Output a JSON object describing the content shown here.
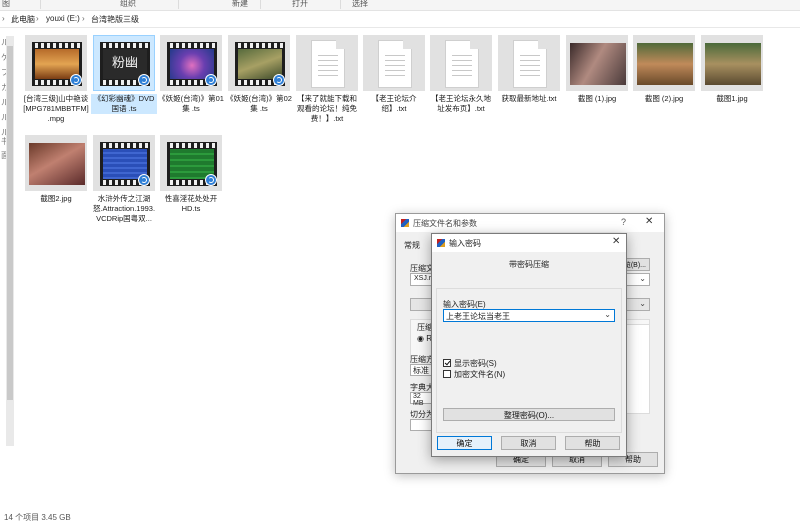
{
  "ribbon": {
    "items": [
      "图",
      "组织",
      "新建",
      "打开",
      "选择"
    ]
  },
  "address": {
    "parts": [
      "此电脑",
      "youxi (E:)",
      "台湾艳版三级"
    ]
  },
  "left_pane": {
    "chars": [
      "ル",
      "ケ",
      "プ",
      "カ",
      "ル",
      "ル",
      "ル",
      "书",
      "面"
    ]
  },
  "files": [
    {
      "name": "[台湾三级]山中艳谈[MPG781MBBTFM].mpg",
      "kind": "video",
      "selected": false
    },
    {
      "name": "《幻彩幽魂》DVD国语 .ts",
      "kind": "video",
      "selected": true
    },
    {
      "name": "《妖姬(台湾)》第01集 .ts",
      "kind": "video",
      "selected": false
    },
    {
      "name": "《妖姬(台湾)》第02集 .ts",
      "kind": "video",
      "selected": false
    },
    {
      "name": "【来了就能下载和观看的论坛！纯免费！】.txt",
      "kind": "text",
      "selected": false
    },
    {
      "name": "【老王论坛介绍】.txt",
      "kind": "text",
      "selected": false
    },
    {
      "name": "【老王论坛永久地址发布页】.txt",
      "kind": "text",
      "selected": false
    },
    {
      "name": "获取最新地址.txt",
      "kind": "text",
      "selected": false
    },
    {
      "name": "截图 (1).jpg",
      "kind": "image",
      "selected": false
    },
    {
      "name": "截图 (2).jpg",
      "kind": "image",
      "selected": false
    },
    {
      "name": "截图1.jpg",
      "kind": "image",
      "selected": false
    },
    {
      "name": "截图2.jpg",
      "kind": "image",
      "selected": false
    },
    {
      "name": "水浒外传之江湖怒.Attraction.1993.VCDRip国粤双...",
      "kind": "video",
      "selected": false
    },
    {
      "name": "性喜淫花处处开HD.ts",
      "kind": "video",
      "selected": false
    }
  ],
  "thumb_text": {
    "video_2": "粉幽"
  },
  "status": {
    "text": "14 个项目 3.45 GB"
  },
  "archive_dialog": {
    "title": "压缩文件名和参数",
    "help_glyph": "?",
    "close_glyph": "✕",
    "tab_general": "常规",
    "label_archive": "压缩文",
    "archive_value": "XSJ.ra",
    "browse_label": "浏览(B)...",
    "label_format": "压缩文",
    "format_rar": "RA",
    "label_method": "压缩方",
    "method_value": "标准",
    "label_dict": "字典大",
    "dict_value": "32 MB",
    "label_split": "切分为",
    "ok_label": "确定",
    "cancel_label": "取消",
    "help_label": "帮助"
  },
  "password_dialog": {
    "title": "输入密码",
    "close_glyph": "✕",
    "heading": "带密码压缩",
    "password_label": "输入密码(E)",
    "password_value": "上老王论坛当老王",
    "show_password_label": "显示密码(S)",
    "show_password_checked": true,
    "encrypt_names_label": "加密文件名(N)",
    "encrypt_names_checked": false,
    "organize_label": "整理密码(O)...",
    "ok_label": "确定",
    "cancel_label": "取消",
    "help_label": "帮助"
  },
  "colors": {
    "selection": "#cce8ff",
    "accent": "#0078d7",
    "dialog_bg": "#f0f0f0"
  }
}
